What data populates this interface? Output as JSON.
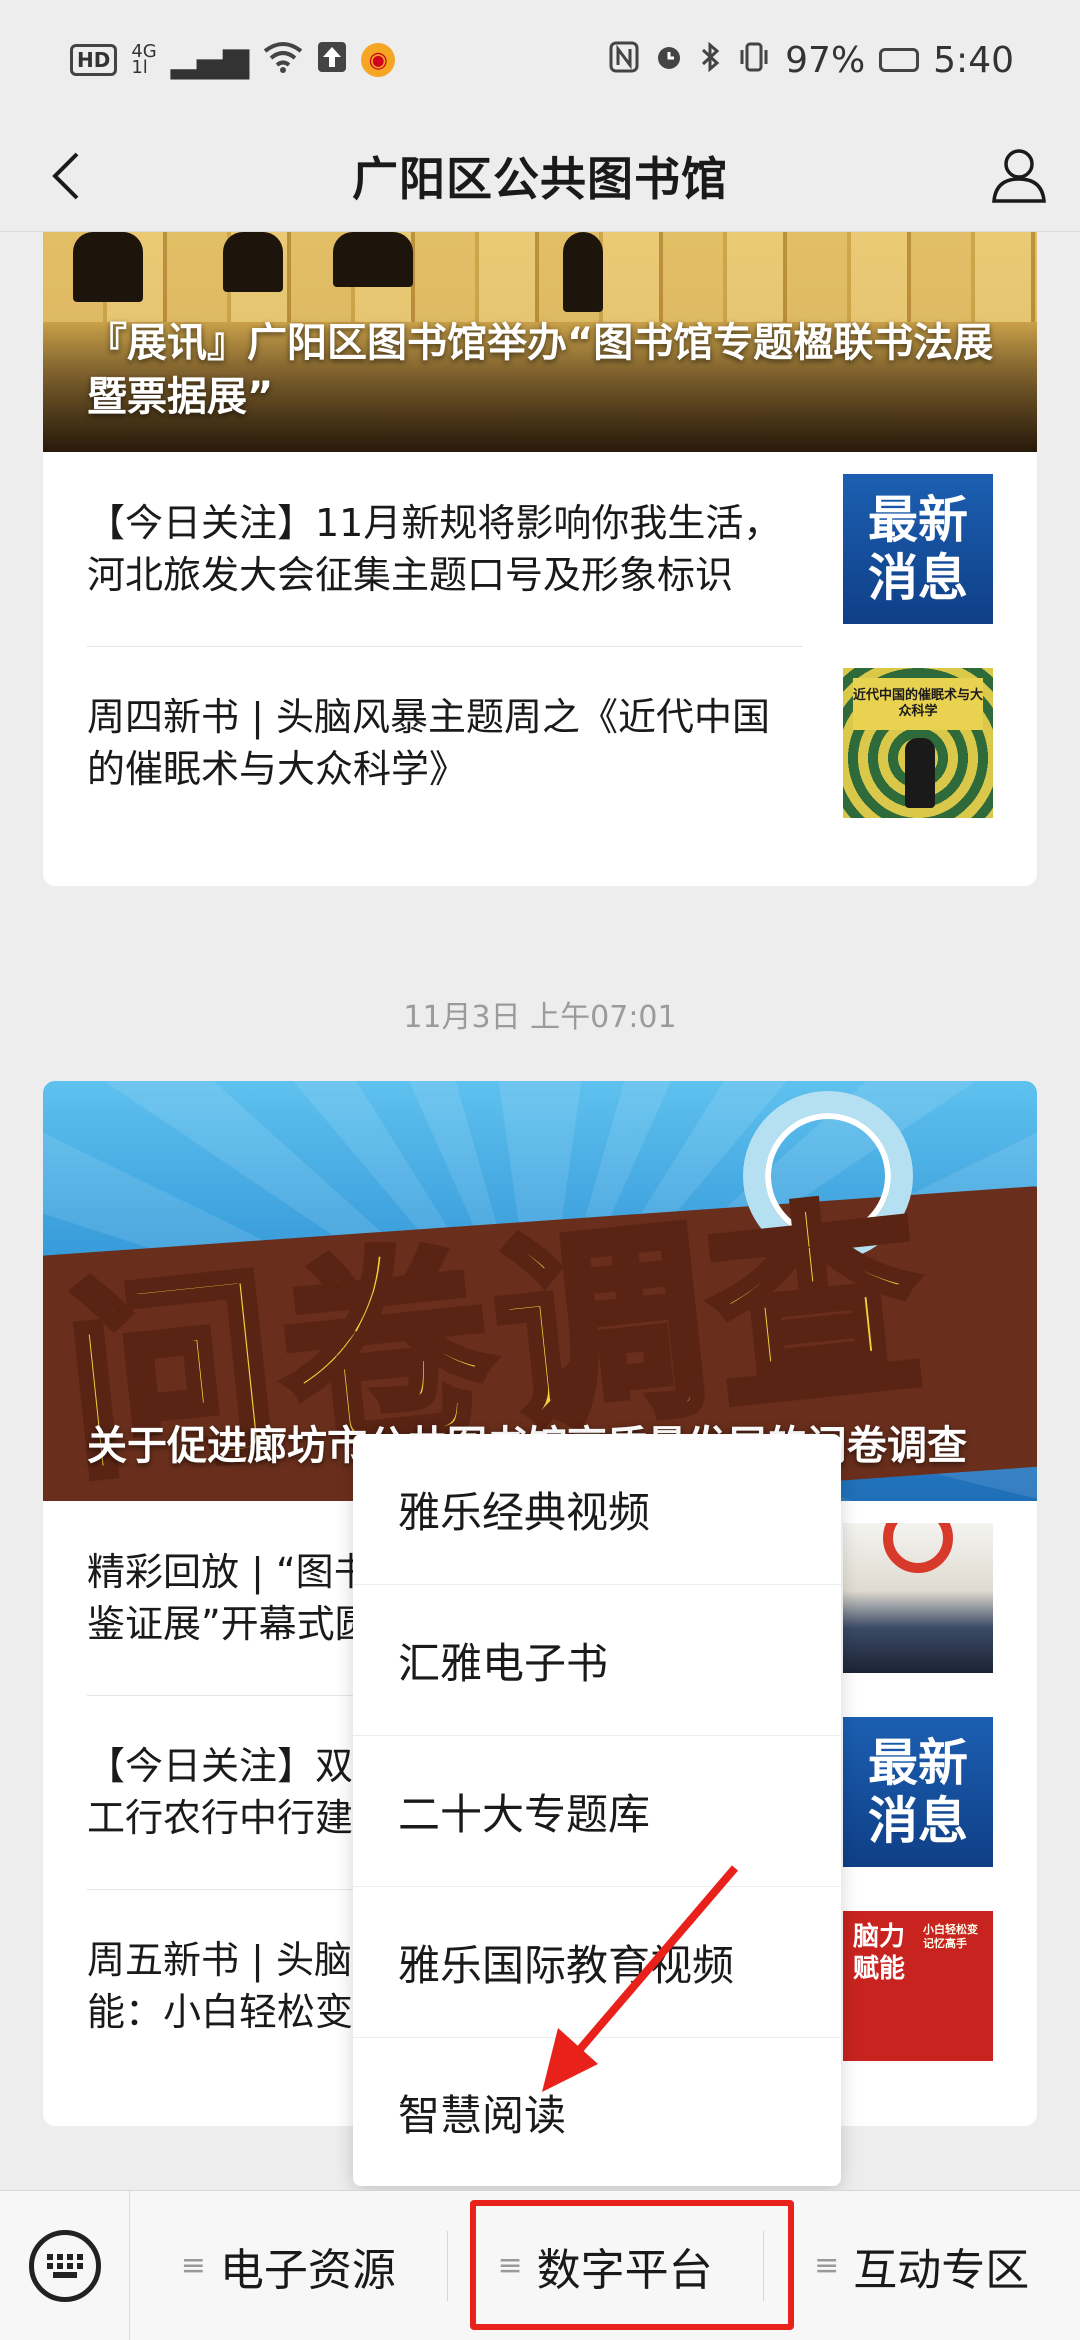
{
  "status_bar": {
    "left_badge": "HD",
    "network_top": "4G",
    "network_bottom": "1l",
    "battery_percent": "97%",
    "time": "5:40"
  },
  "nav": {
    "title": "广阳区公共图书馆"
  },
  "feed": {
    "card1": {
      "hero_title": "『展讯』广阳区图书馆举办“图书馆专题楹联书法展暨票据展”",
      "rows": [
        {
          "text": "【今日关注】11月新规将影响你我生活，河北旅发大会征集主题口号及形象标识",
          "thumb_line1": "最新",
          "thumb_line2": "消息"
        },
        {
          "text": "周四新书 | 头脑风暴主题周之《近代中国的催眠术与大众科学》",
          "thumb_caption": "近代中国的催眠术与大众科学"
        }
      ]
    },
    "timestamp": "11月3日 上午07:01",
    "card2": {
      "hero_bigtext": "问卷调查",
      "hero_title": "关于促进廊坊市公共图书馆高质量发展的问卷调查",
      "rows": [
        {
          "text": "精彩回放 | “图书馆专题楹联书法展暨票据鉴证展”开幕式圆满举办"
        },
        {
          "text": "【今日关注】双预警！明天起降温降雨，工行农行中行建行同步宣布",
          "thumb_line1": "最新",
          "thumb_line2": "消息"
        },
        {
          "text": "周五新书 | 头脑风暴主题周之《脑力赋能：小白轻松变记忆高手》",
          "thumb_title": "脑力赋能",
          "thumb_side": "小白轻松变记忆高手"
        }
      ]
    }
  },
  "popup_menu": {
    "items": [
      "雅乐经典视频",
      "汇雅电子书",
      "二十大专题库",
      "雅乐国际教育视频",
      "智慧阅读"
    ]
  },
  "bottom_menu": {
    "tabs": [
      "电子资源",
      "数字平台",
      "互动专区"
    ],
    "tab_icon": "≡"
  },
  "colors": {
    "highlight": "#e8221b",
    "background": "#ededed"
  }
}
